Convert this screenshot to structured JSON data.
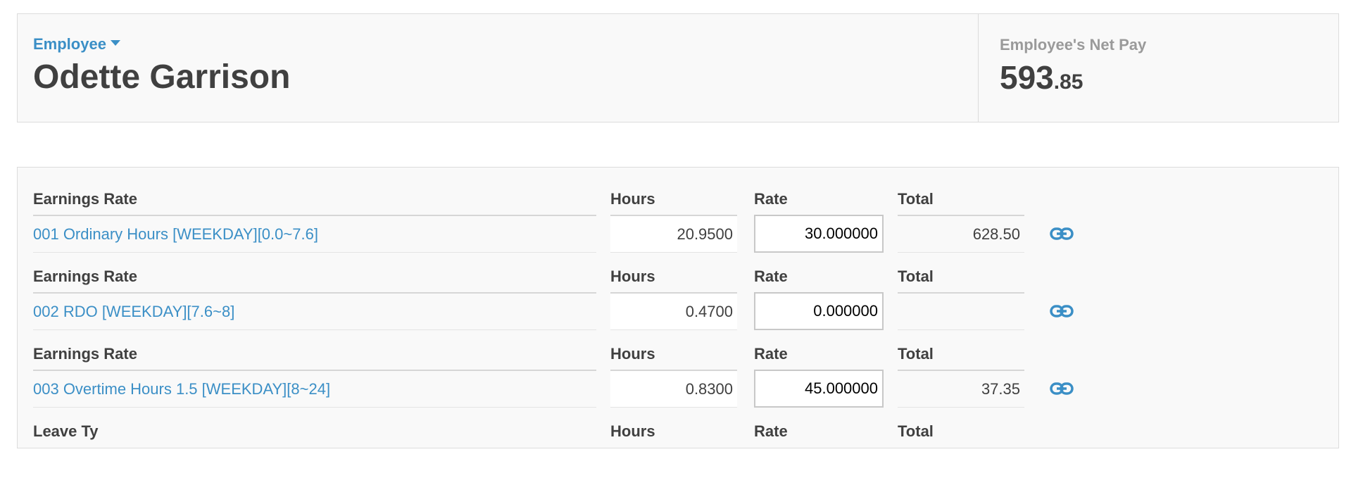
{
  "employee": {
    "label": "Employee",
    "name": "Odette Garrison"
  },
  "net_pay": {
    "label": "Employee's Net Pay",
    "main": "593",
    "cents": ".85"
  },
  "earnings": {
    "headers": {
      "earnings_rate": "Earnings Rate",
      "hours": "Hours",
      "rate": "Rate",
      "total": "Total"
    },
    "rows": [
      {
        "name": "001 Ordinary Hours [WEEKDAY][0.0~7.6]",
        "hours": "20.9500",
        "rate": "30.000000",
        "total": "628.50",
        "icon": "link-icon"
      },
      {
        "name": "002 RDO [WEEKDAY][7.6~8]",
        "hours": "0.4700",
        "rate": "0.000000",
        "total": "",
        "icon": "link-icon"
      },
      {
        "name": "003 Overtime Hours 1.5 [WEEKDAY][8~24]",
        "hours": "0.8300",
        "rate": "45.000000",
        "total": "37.35",
        "icon": "link-icon"
      },
      {
        "name": "",
        "hours": "",
        "rate": "",
        "total": "",
        "icon": "link-icon"
      }
    ],
    "partial_header": {
      "earnings_rate": "Leave Ty",
      "hours": "Hours",
      "rate": "Rate",
      "total": "Total"
    }
  },
  "colors": {
    "link": "#3b8fc6",
    "text": "#404040",
    "muted": "#9a9a9a",
    "panel_bg": "#f9f9f9",
    "border": "#dcdcdc"
  }
}
